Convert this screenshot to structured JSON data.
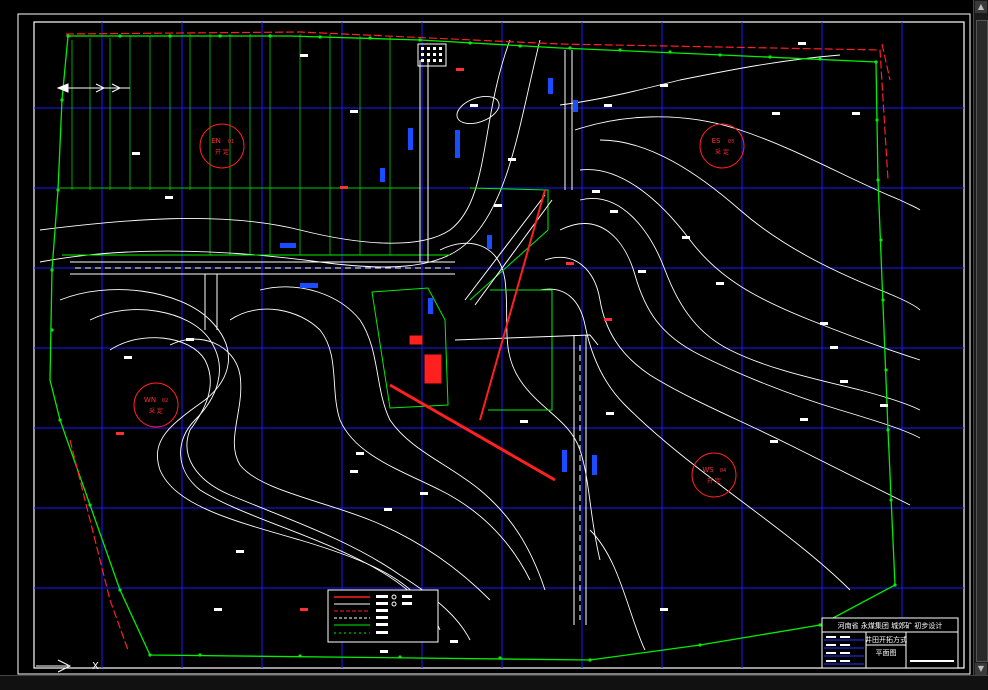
{
  "colors": {
    "background": "#000000",
    "grid": "#0000ff",
    "contours": "#ffffff",
    "boundary": "#00ff00",
    "mine_boundary": "#ff2020",
    "frame": "#ffffff"
  },
  "zones": [
    {
      "code": "EN",
      "sub": "01",
      "status": "开 定"
    },
    {
      "code": "ES",
      "sub": "03",
      "status": "采 定"
    },
    {
      "code": "WN",
      "sub": "02",
      "status": "采 定"
    },
    {
      "code": "WS",
      "sub": "04",
      "status": "开 定"
    }
  ],
  "title_block": {
    "project": "河南省 永煤集团 城郊矿 初步设计",
    "drawing_name": "井田开拓方式",
    "drawing_type": "平面图"
  },
  "axis_label": "X",
  "icons": [
    "north-arrow-icon",
    "ucs-icon",
    "scroll-up-icon",
    "scroll-down-icon"
  ]
}
